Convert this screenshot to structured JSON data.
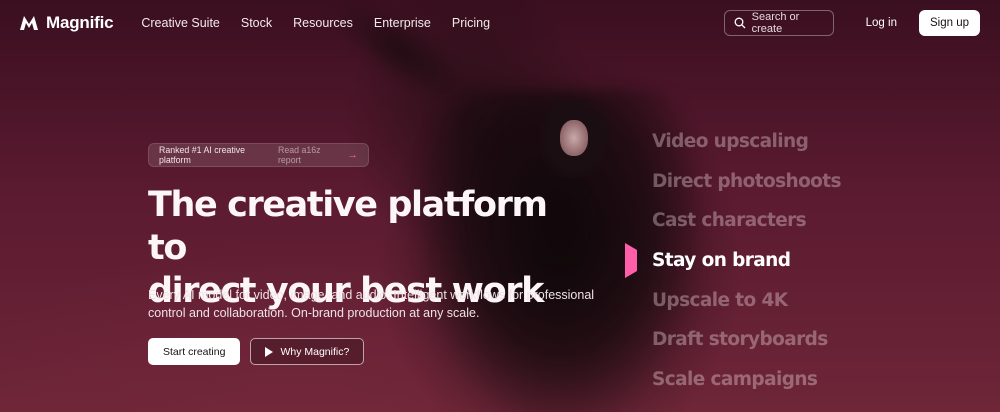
{
  "nav": {
    "logo_text": "Magnific",
    "links": [
      "Creative Suite",
      "Stock",
      "Resources",
      "Enterprise",
      "Pricing"
    ],
    "search_placeholder": "Search or create",
    "login_label": "Log in",
    "signup_label": "Sign up"
  },
  "hero": {
    "badge_text": "Ranked #1 AI creative platform",
    "badge_link": "Read a16z report",
    "headline_line1": "The creative platform to",
    "headline_line2": "direct your best work",
    "subcopy_line1": "Every AI model for video, image, and audio. Intelligent workflows for professional",
    "subcopy_line2": "control and collaboration. On-brand production at any scale.",
    "primary_cta": "Start creating",
    "secondary_cta": "Why Magnific?"
  },
  "features": {
    "items": [
      "Video upscaling",
      "Direct photoshoots",
      "Cast characters",
      "Stay on brand",
      "Upscale to 4K",
      "Draft storyboards",
      "Scale campaigns"
    ],
    "active_index": 3
  },
  "colors": {
    "accent": "#ff5fa8",
    "background": "#4a1528"
  }
}
